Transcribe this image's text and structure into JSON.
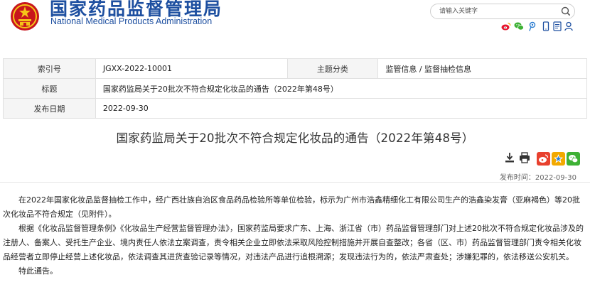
{
  "header": {
    "brand_cn": "国家药品监督管理局",
    "brand_en": "National Medical Products Administration",
    "search_placeholder": "请输入关键字",
    "share_icons": [
      "weibo-icon",
      "wechat-icon",
      "tencent-weibo-icon",
      "mobile-icon",
      "text-size-icon",
      "user-icon"
    ]
  },
  "meta": {
    "index_label": "索引号",
    "index_value": "JGXX-2022-10001",
    "topic_label": "主题分类",
    "topic_value": "监管信息 / 监督抽检信息",
    "title_label": "标题",
    "title_value": "国家药监局关于20批次不符合规定化妆品的通告（2022年第48号）",
    "date_label": "发布日期",
    "date_value": "2022-09-30"
  },
  "article": {
    "title": "国家药监局关于20批次不符合规定化妆品的通告（2022年第48号）",
    "publish_label": "发布时间：2022-09-30",
    "paragraphs": [
      "　　在2022年国家化妆品监督抽检工作中，经广西壮族自治区食品药品检验所等单位检验，标示为广州市浩鑫精细化工有限公司生产的浩鑫染发膏（亚麻褐色）等20批次化妆品不符合规定（见附件）。",
      "　　根据《化妆品监督管理条例》《化妆品生产经营监督管理办法》，国家药监局要求广东、上海、浙江省（市）药品监督管理部门对上述20批次不符合规定化妆品涉及的注册人、备案人、受托生产企业、境内责任人依法立案调查，责令相关企业立即依法采取风险控制措施并开展自查整改；各省（区、市）药品监督管理部门责令相关化妆品经营者立即停止经营上述化妆品，依法调查其进货查验记录等情况，对违法产品进行追根溯源；发现违法行为的，依法严肃查处；涉嫌犯罪的，依法移送公安机关。",
      "　　特此通告。"
    ]
  },
  "colors": {
    "brand_blue": "#1d4fa0",
    "weibo_red": "#e6162d",
    "wechat_green": "#3eb135",
    "tools_red": "#e8412e",
    "tools_gold": "#f2a900"
  }
}
